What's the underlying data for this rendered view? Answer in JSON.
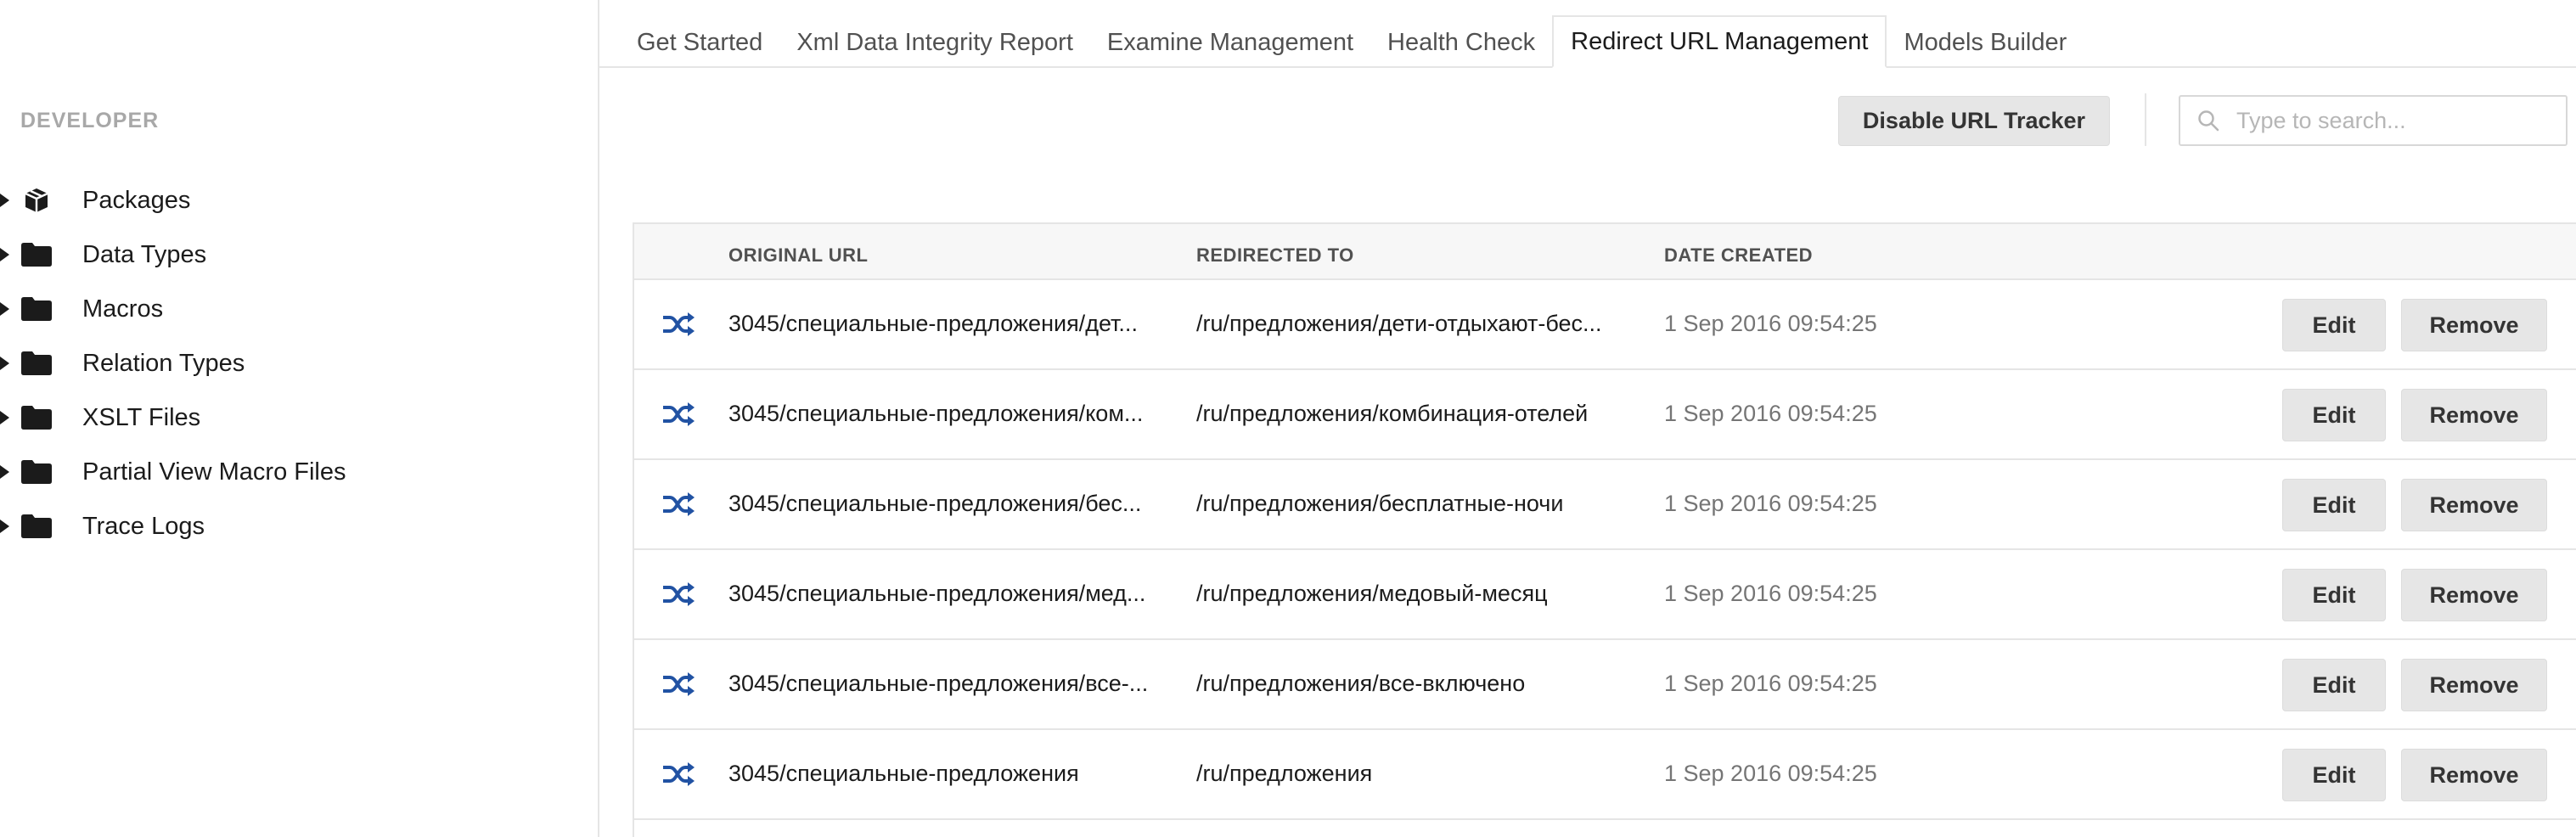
{
  "sidebar": {
    "title": "DEVELOPER",
    "items": [
      {
        "label": "Packages",
        "icon": "package-icon"
      },
      {
        "label": "Data Types",
        "icon": "folder-icon"
      },
      {
        "label": "Macros",
        "icon": "folder-icon"
      },
      {
        "label": "Relation Types",
        "icon": "folder-icon"
      },
      {
        "label": "XSLT Files",
        "icon": "folder-icon"
      },
      {
        "label": "Partial View Macro Files",
        "icon": "folder-icon"
      },
      {
        "label": "Trace Logs",
        "icon": "folder-icon"
      }
    ]
  },
  "tabs": [
    {
      "label": "Get Started"
    },
    {
      "label": "Xml Data Integrity Report"
    },
    {
      "label": "Examine Management"
    },
    {
      "label": "Health Check"
    },
    {
      "label": "Redirect URL Management",
      "active": true
    },
    {
      "label": "Models Builder"
    }
  ],
  "toolbar": {
    "disable_label": "Disable URL Tracker",
    "search_placeholder": "Type to search..."
  },
  "table": {
    "headers": {
      "original_url": "ORIGINAL URL",
      "redirected_to": "REDIRECTED TO",
      "date_created": "DATE CREATED"
    },
    "edit_label": "Edit",
    "remove_label": "Remove",
    "rows": [
      {
        "original": "3045/специальные-предложения/дет...",
        "redirected": "/ru/предложения/дети-отдыхают-бес...",
        "date": "1 Sep 2016 09:54:25"
      },
      {
        "original": "3045/специальные-предложения/ком...",
        "redirected": "/ru/предложения/комбинация-отелей",
        "date": "1 Sep 2016 09:54:25"
      },
      {
        "original": "3045/специальные-предложения/бес...",
        "redirected": "/ru/предложения/бесплатные-ночи",
        "date": "1 Sep 2016 09:54:25"
      },
      {
        "original": "3045/специальные-предложения/мед...",
        "redirected": "/ru/предложения/медовый-месяц",
        "date": "1 Sep 2016 09:54:25"
      },
      {
        "original": "3045/специальные-предложения/все-...",
        "redirected": "/ru/предложения/все-включено",
        "date": "1 Sep 2016 09:54:25"
      },
      {
        "original": "3045/специальные-предложения",
        "redirected": "/ru/предложения",
        "date": "1 Sep 2016 09:54:25"
      }
    ]
  },
  "colors": {
    "accent_blue": "#2152a3",
    "button_bg": "#e6e6e6",
    "border": "#e5e5e5"
  }
}
